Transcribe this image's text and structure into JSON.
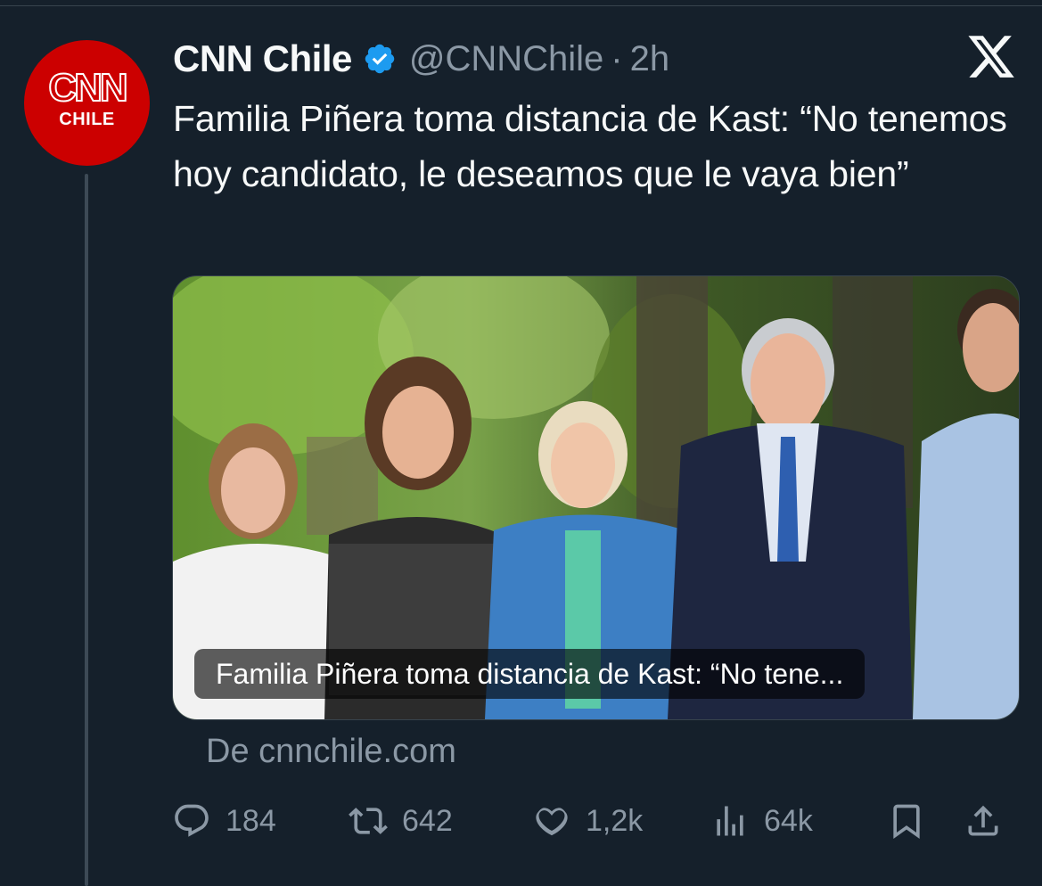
{
  "tweet": {
    "author_name": "CNN Chile",
    "handle": "@CNNChile",
    "separator": "·",
    "time": "2h",
    "avatar": {
      "logo_text": "CNN",
      "sub_text": "CHILE",
      "color": "#cc0000"
    },
    "text": "Familia Piñera toma distancia de Kast: “No tenemos hoy candidato, le deseamos que le vaya bien”",
    "verified_color": "#1d9bf0"
  },
  "media": {
    "caption": "Familia Piñera toma distancia de Kast: “No tene...",
    "source": "De cnnchile.com"
  },
  "actions": {
    "replies": "184",
    "retweets": "642",
    "likes": "1,2k",
    "views": "64k"
  },
  "icons": {
    "reply": "reply-icon",
    "retweet": "retweet-icon",
    "like": "heart-icon",
    "views": "views-icon",
    "bookmark": "bookmark-icon",
    "share": "share-icon",
    "brand": "x-logo-icon",
    "verified": "verified-badge-icon"
  },
  "colors": {
    "background": "#15202b",
    "text_primary": "#f7f9f9",
    "text_secondary": "#8b98a5"
  }
}
